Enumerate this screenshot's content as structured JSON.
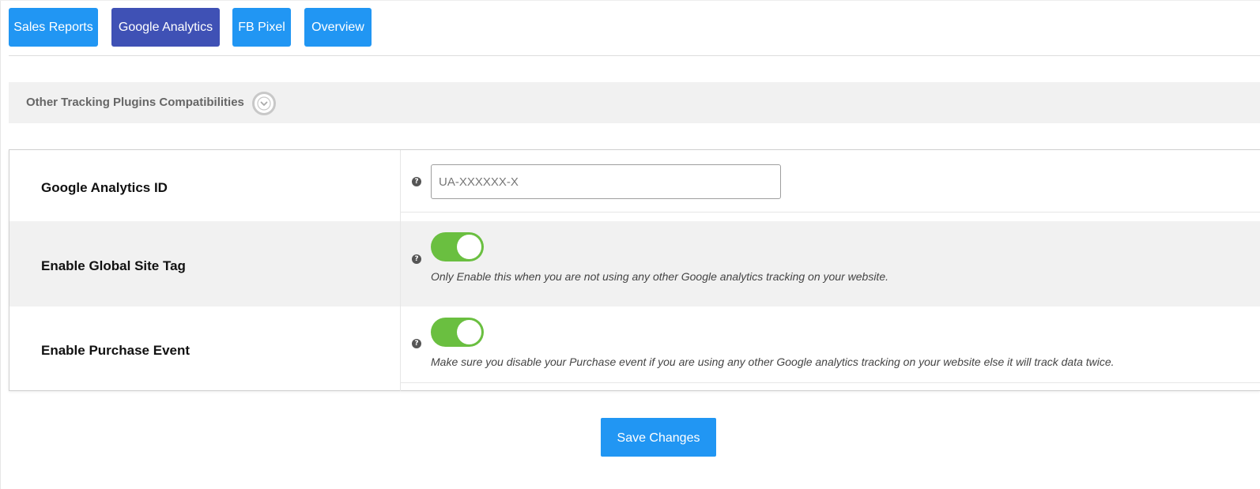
{
  "tabs": [
    {
      "label": "Sales Reports",
      "active": false
    },
    {
      "label": "Google Analytics",
      "active": true
    },
    {
      "label": "FB Pixel",
      "active": false
    },
    {
      "label": "Overview",
      "active": false
    }
  ],
  "collapse_section": {
    "title": "Other Tracking Plugins Compatibilities",
    "icon": "chevron-down-circle-icon"
  },
  "settings": {
    "ga_id": {
      "label": "Google Analytics ID",
      "placeholder": "UA-XXXXXX-X",
      "value": "",
      "help_icon": "?"
    },
    "global_site_tag": {
      "label": "Enable Global Site Tag",
      "enabled": true,
      "description": "Only Enable this when you are not using any other Google analytics tracking on your website.",
      "help_icon": "?"
    },
    "purchase_event": {
      "label": "Enable Purchase Event",
      "enabled": true,
      "description": "Make sure you disable your Purchase event if you are using any other Google analytics tracking on your website else it will track data twice.",
      "help_icon": "?"
    }
  },
  "save_button": {
    "label": "Save Changes"
  },
  "colors": {
    "tab": "#2196f3",
    "tab_active": "#3f51b5",
    "toggle_on": "#6abf40",
    "panel_bg": "#f1f1f1",
    "primary_button": "#2196f3"
  }
}
